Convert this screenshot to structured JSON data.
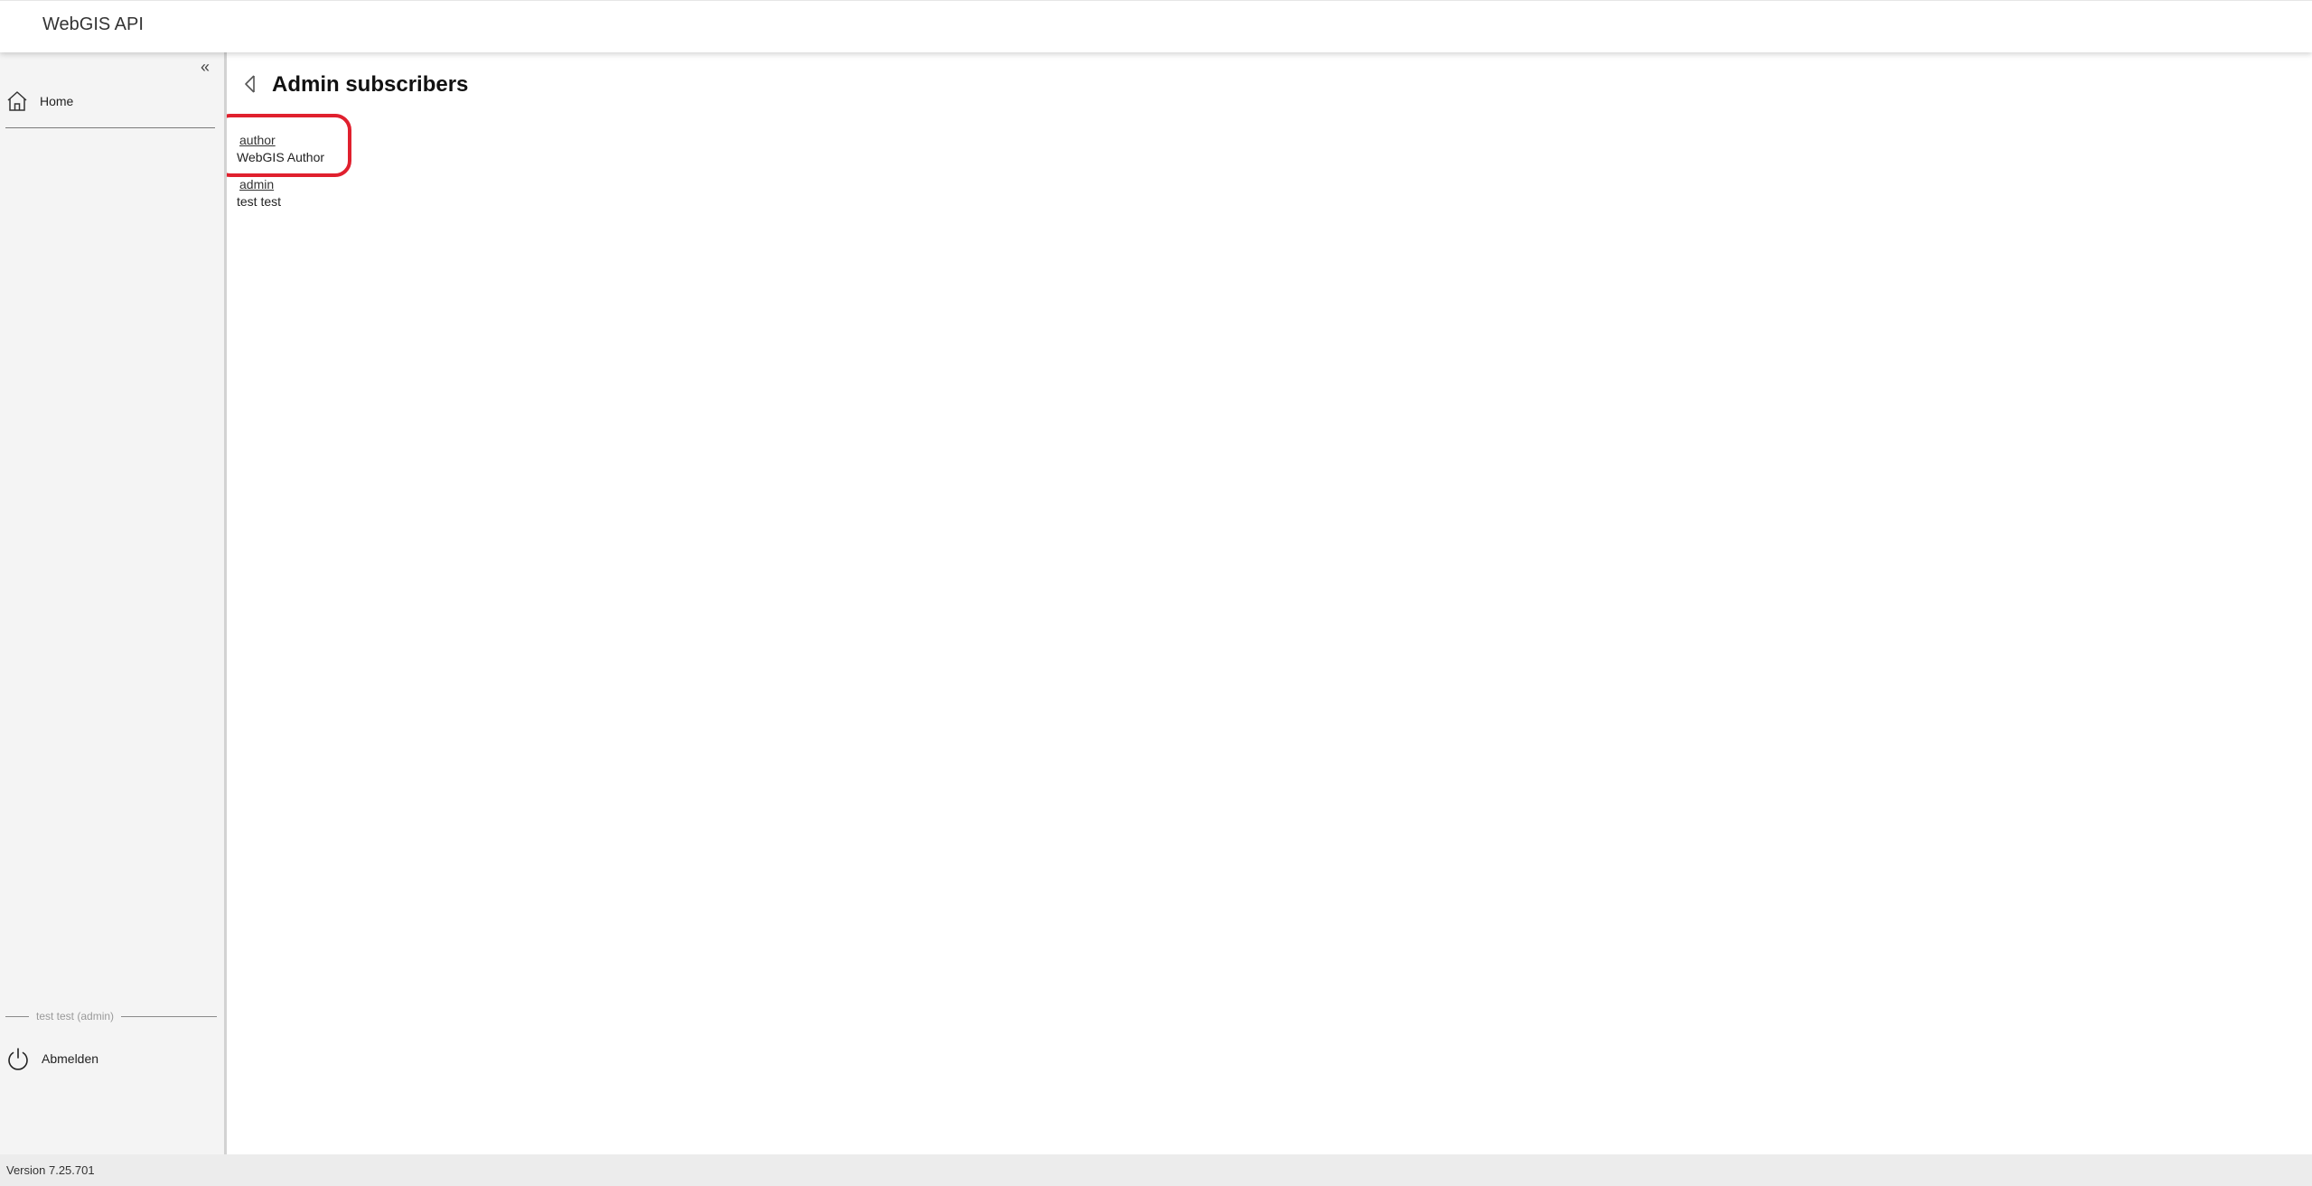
{
  "header": {
    "title": "WebGIS API"
  },
  "sidebar": {
    "collapse_label": "«",
    "home_label": "Home",
    "user_caption": "test test (admin)",
    "logout_label": "Abmelden"
  },
  "main": {
    "page_title": "Admin subscribers",
    "subscribers": [
      {
        "username": "author",
        "fullname": "WebGIS Author"
      },
      {
        "username": "admin",
        "fullname": "test test"
      }
    ]
  },
  "footer": {
    "version": "Version 7.25.701"
  },
  "colors": {
    "highlight": "#e0202e",
    "sidebar_bg": "#f4f4f4",
    "footer_bg": "#ececec"
  },
  "icons": {
    "home": "home-icon",
    "logout": "power-icon",
    "back": "back-arrow-icon"
  }
}
